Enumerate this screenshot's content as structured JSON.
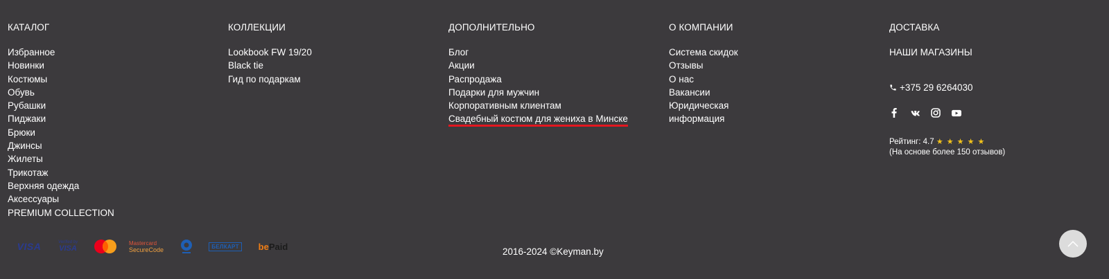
{
  "catalog": {
    "title": "КАТАЛОГ",
    "items": [
      "Избранное",
      "Новинки",
      "Костюмы",
      "Обувь",
      "Рубашки",
      "Пиджаки",
      "Брюки",
      "Джинсы",
      "Жилеты",
      "Трикотаж",
      "Верхняя одежда",
      "Аксессуары",
      "PREMIUM COLLECTION"
    ]
  },
  "collections": {
    "title": "КОЛЛЕКЦИИ",
    "items": [
      "Lookbook FW 19/20",
      "Black tie",
      "Гид по подаркам"
    ]
  },
  "extra": {
    "title": "ДОПОЛНИТЕЛЬНО",
    "items": [
      "Блог",
      "Акции",
      "Распродажа",
      "Подарки для мужчин",
      "Корпоративным клиентам",
      "Свадебный костюм для жениха в Минске"
    ]
  },
  "company": {
    "title": "О КОМПАНИИ",
    "items": [
      "Система скидок",
      "Отзывы",
      "О нас",
      "Вакансии",
      "Юридическая",
      "информация"
    ]
  },
  "delivery": {
    "title": "ДОСТАВКА",
    "stores": "НАШИ МАГАЗИНЫ",
    "phone": "+375 29 6264030",
    "socials": [
      "facebook-icon",
      "vk-icon",
      "instagram-icon",
      "youtube-icon"
    ],
    "rating_label": "Рейтинг: 4.7",
    "rating_value": 4.7,
    "stars": "★ ★ ★ ★ ★",
    "rating_note": "(На основе более 150 отзывов)"
  },
  "payments": {
    "visa": "VISA",
    "verified_top": "Verified by",
    "verified_bottom": "VISA",
    "mc_top": "Mastercard",
    "mc_bottom": "SecureCode",
    "belkart": "БЕЛКАРТ",
    "bepaid_be": "be",
    "bepaid_paid": "Paid"
  },
  "footer": {
    "copyright": "2016-2024 ©Keyman.by"
  },
  "colors": {
    "background": "#3c3a3d",
    "accent_underline": "#e3161f",
    "stars": "#f2c21b"
  }
}
